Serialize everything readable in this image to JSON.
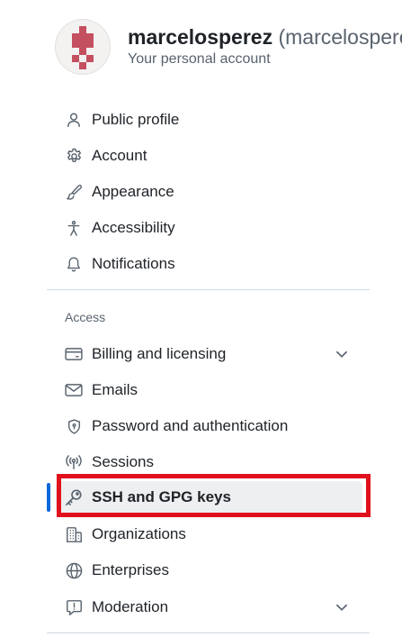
{
  "account": {
    "name": "marcelosperez",
    "login": "(marcelosperez)",
    "subtitle": "Your personal account"
  },
  "nav": {
    "general": [
      {
        "label": "Public profile",
        "icon": "person-icon"
      },
      {
        "label": "Account",
        "icon": "gear-icon"
      },
      {
        "label": "Appearance",
        "icon": "paintbrush-icon"
      },
      {
        "label": "Accessibility",
        "icon": "accessibility-icon"
      },
      {
        "label": "Notifications",
        "icon": "bell-icon"
      }
    ],
    "access_heading": "Access",
    "access": [
      {
        "label": "Billing and licensing",
        "icon": "credit-card-icon",
        "expandable": true
      },
      {
        "label": "Emails",
        "icon": "mail-icon"
      },
      {
        "label": "Password and authentication",
        "icon": "shield-lock-icon"
      },
      {
        "label": "Sessions",
        "icon": "broadcast-icon"
      },
      {
        "label": "SSH and GPG keys",
        "icon": "key-icon",
        "selected": true
      },
      {
        "label": "Organizations",
        "icon": "organization-icon"
      },
      {
        "label": "Enterprises",
        "icon": "globe-icon"
      },
      {
        "label": "Moderation",
        "icon": "report-icon",
        "expandable": true
      }
    ]
  },
  "colors": {
    "accent": "#0969da",
    "highlight_box": "#e0111c",
    "selected_bg": "#eeeff1",
    "avatar_pattern": "#c4505f"
  }
}
